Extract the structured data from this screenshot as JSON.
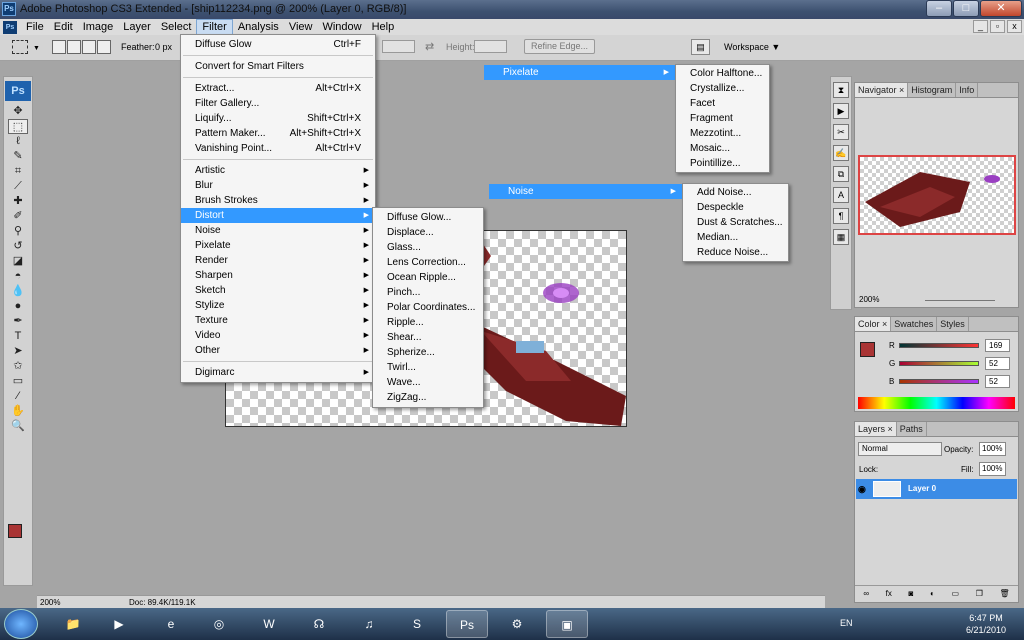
{
  "window": {
    "title": "Adobe Photoshop CS3 Extended - [ship112234.png @ 200% (Layer 0, RGB/8)]",
    "app_badge": "Ps"
  },
  "menubar": [
    "File",
    "Edit",
    "Image",
    "Layer",
    "Select",
    "Filter",
    "Analysis",
    "View",
    "Window",
    "Help"
  ],
  "optionsbar": {
    "feather_label": "Feather:",
    "feather_value": "0 px",
    "height_label": "Height:",
    "refine_edge": "Refine Edge...",
    "workspace": "Workspace ▼"
  },
  "filter_menu": {
    "items": [
      {
        "label": "Diffuse Glow",
        "shortcut": "Ctrl+F"
      },
      {
        "label": "Convert for Smart Filters",
        "shortcut": ""
      },
      {
        "label": "Extract...",
        "shortcut": "Alt+Ctrl+X"
      },
      {
        "label": "Filter Gallery...",
        "shortcut": ""
      },
      {
        "label": "Liquify...",
        "shortcut": "Shift+Ctrl+X"
      },
      {
        "label": "Pattern Maker...",
        "shortcut": "Alt+Shift+Ctrl+X"
      },
      {
        "label": "Vanishing Point...",
        "shortcut": "Alt+Ctrl+V"
      },
      {
        "label": "Artistic",
        "shortcut": ""
      },
      {
        "label": "Blur",
        "shortcut": ""
      },
      {
        "label": "Brush Strokes",
        "shortcut": ""
      },
      {
        "label": "Distort",
        "shortcut": ""
      },
      {
        "label": "Noise",
        "shortcut": ""
      },
      {
        "label": "Pixelate",
        "shortcut": ""
      },
      {
        "label": "Render",
        "shortcut": ""
      },
      {
        "label": "Sharpen",
        "shortcut": ""
      },
      {
        "label": "Sketch",
        "shortcut": ""
      },
      {
        "label": "Stylize",
        "shortcut": ""
      },
      {
        "label": "Texture",
        "shortcut": ""
      },
      {
        "label": "Video",
        "shortcut": ""
      },
      {
        "label": "Other",
        "shortcut": ""
      },
      {
        "label": "Digimarc",
        "shortcut": ""
      }
    ]
  },
  "distort_menu": [
    "Diffuse Glow...",
    "Displace...",
    "Glass...",
    "Lens Correction...",
    "Ocean Ripple...",
    "Pinch...",
    "Polar Coordinates...",
    "Ripple...",
    "Shear...",
    "Spherize...",
    "Twirl...",
    "Wave...",
    "ZigZag..."
  ],
  "pixelate": {
    "label": "Pixelate",
    "items": [
      "Color Halftone...",
      "Crystallize...",
      "Facet",
      "Fragment",
      "Mezzotint...",
      "Mosaic...",
      "Pointillize..."
    ]
  },
  "noise": {
    "label": "Noise",
    "items": [
      "Add Noise...",
      "Despeckle",
      "Dust & Scratches...",
      "Median...",
      "Reduce Noise..."
    ]
  },
  "navigator": {
    "tabs": [
      "Navigator ×",
      "Histogram",
      "Info"
    ],
    "zoom": "200%"
  },
  "color_panel": {
    "tabs": [
      "Color ×",
      "Swatches",
      "Styles"
    ],
    "r_label": "R",
    "r": "169",
    "g_label": "G",
    "g": "52",
    "b_label": "B",
    "b": "52",
    "foreground": "#a93434"
  },
  "layers_panel": {
    "tabs": [
      "Layers ×",
      "Paths"
    ],
    "blend_mode": "Normal",
    "opacity_label": "Opacity:",
    "opacity": "100%",
    "lock_label": "Lock:",
    "fill_label": "Fill:",
    "fill": "100%",
    "layer_name": "Layer 0"
  },
  "statusbar": {
    "zoom": "200%",
    "doc": "Doc: 89.4K/119.1K"
  },
  "taskbar": {
    "language": "EN",
    "time": "6:47 PM",
    "date": "6/21/2010",
    "active_app": "Ps"
  }
}
